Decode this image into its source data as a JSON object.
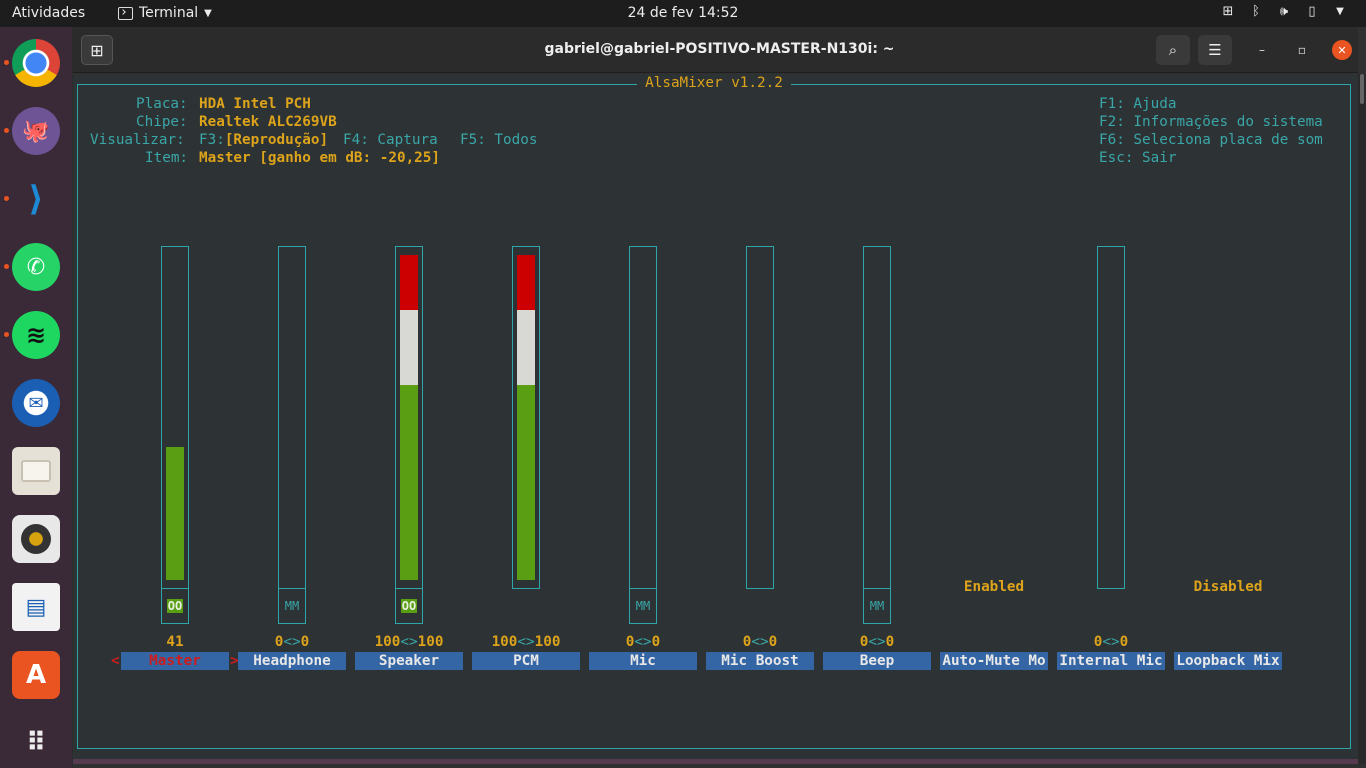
{
  "topbar": {
    "activities": "Atividades",
    "app_menu": "Terminal",
    "datetime": "24 de fev  14:52"
  },
  "dock": {
    "apps": [
      {
        "name": "Google Chrome",
        "icon": "chrome-icon",
        "running": true
      },
      {
        "name": "GitHub Desktop",
        "icon": "github-icon",
        "running": true
      },
      {
        "name": "Visual Studio Code",
        "icon": "vscode-icon",
        "running": true
      },
      {
        "name": "WhatsApp",
        "icon": "whatsapp-icon",
        "running": true
      },
      {
        "name": "Spotify",
        "icon": "spotify-icon",
        "running": true
      },
      {
        "name": "Thunderbird",
        "icon": "thunderbird-icon",
        "running": false
      },
      {
        "name": "Files",
        "icon": "files-icon",
        "running": false
      },
      {
        "name": "Rhythmbox",
        "icon": "rhythmbox-icon",
        "running": false
      },
      {
        "name": "LibreOffice Writer",
        "icon": "writer-icon",
        "running": false
      },
      {
        "name": "Ubuntu Software",
        "icon": "software-icon",
        "running": false
      },
      {
        "name": "Show Applications",
        "icon": "app-grid-icon",
        "running": false
      }
    ]
  },
  "window": {
    "title": "gabriel@gabriel-POSITIVO-MASTER-N130i: ~"
  },
  "alsamixer": {
    "title": "AlsaMixer v1.2.2",
    "info": {
      "card_label": "Placa:",
      "card": "HDA Intel PCH",
      "chip_label": "Chipe:",
      "chip": "Realtek ALC269VB",
      "view_label": "Visualizar:",
      "view_f3": "F3:",
      "view_playback": "[Reprodução]",
      "view_capture": "F4: Captura",
      "view_all": "F5: Todos",
      "item_label": "Item:",
      "item": "Master [ganho em dB: -20,25]"
    },
    "help": {
      "f1": "F1: Ajuda",
      "f2": "F2: Informações do sistema",
      "f6": "F6: Seleciona placa de som",
      "esc": "Esc: Sair"
    },
    "controls": [
      {
        "name": "Master",
        "value": "41",
        "level": 41,
        "red": 0,
        "white": 0,
        "mute": "OO",
        "mute_on": true,
        "selected": true
      },
      {
        "name": "Headphone",
        "value": "0<>0",
        "level": 0,
        "mute": "MM",
        "mute_on": false
      },
      {
        "name": "Speaker",
        "value": "100<>100",
        "level": 100,
        "mute": "OO",
        "mute_on": true
      },
      {
        "name": "PCM",
        "value": "100<>100",
        "level": 100
      },
      {
        "name": "Mic",
        "value": "0<>0",
        "level": 0,
        "mute": "MM",
        "mute_on": false
      },
      {
        "name": "Mic Boost",
        "value": "0<>0",
        "level": 0
      },
      {
        "name": "Beep",
        "value": "0<>0",
        "level": 0,
        "mute": "MM",
        "mute_on": false
      },
      {
        "name": "Auto-Mute Mo",
        "state": "Enabled"
      },
      {
        "name": "Internal Mic",
        "value": "0<>0",
        "level": 0
      },
      {
        "name": "Loopback Mix",
        "state": "Disabled"
      }
    ],
    "colors": {
      "green": "#5a9e13",
      "white": "#d8d8d4",
      "red": "#cc0000",
      "cyan": "#2fa7aa",
      "yellow": "#dca31b",
      "label_bg": "#3465a4"
    }
  }
}
